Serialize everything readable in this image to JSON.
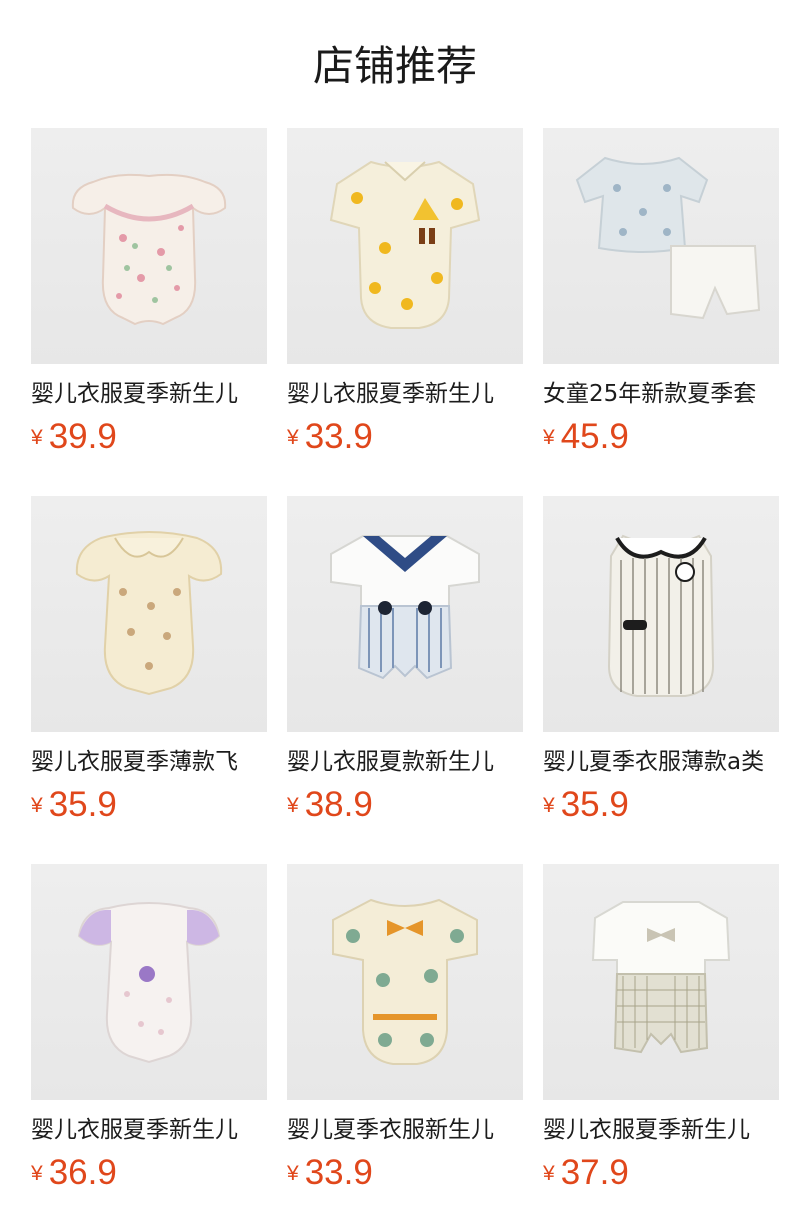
{
  "page_title": "店铺推荐",
  "currency_symbol": "¥",
  "products": [
    {
      "name": "婴儿衣服夏季新生儿",
      "price": "39.9",
      "image": "floral-flutter-romper"
    },
    {
      "name": "婴儿衣服夏季新生儿",
      "price": "33.9",
      "image": "yellow-duck-polo-romper"
    },
    {
      "name": "女童25年新款夏季套",
      "price": "45.9",
      "image": "floral-top-bloomer-set"
    },
    {
      "name": "婴儿衣服夏季薄款飞",
      "price": "35.9",
      "image": "peter-pan-collar-floral-romper"
    },
    {
      "name": "婴儿衣服夏款新生儿",
      "price": "38.9",
      "image": "sailor-collar-stripe-romper"
    },
    {
      "name": "婴儿夏季衣服薄款a类",
      "price": "35.9",
      "image": "panda-collar-stripe-romper"
    },
    {
      "name": "婴儿衣服夏季新生儿",
      "price": "36.9",
      "image": "lavender-lace-romper"
    },
    {
      "name": "婴儿夏季衣服新生儿",
      "price": "33.9",
      "image": "duck-bowtie-romper"
    },
    {
      "name": "婴儿衣服夏季新生儿",
      "price": "37.9",
      "image": "gentleman-bowtie-romper"
    }
  ]
}
